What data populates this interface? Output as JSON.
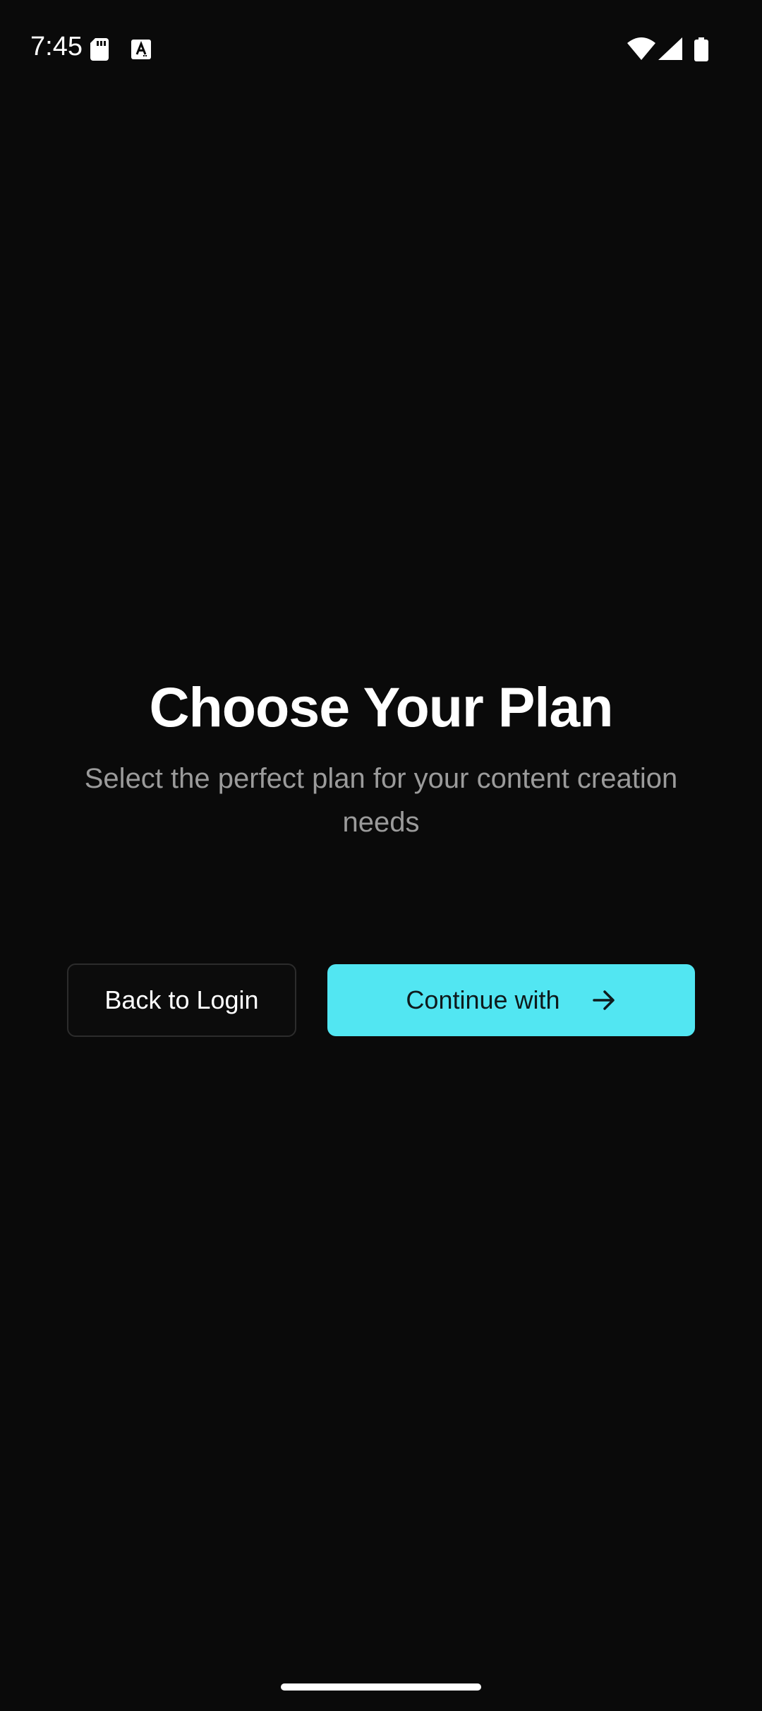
{
  "status_bar": {
    "time": "7:45",
    "icons": [
      "sd-card-icon",
      "text-a-icon",
      "wifi-icon",
      "cell-signal-icon",
      "battery-icon"
    ]
  },
  "page": {
    "title": "Choose Your Plan",
    "subtitle": "Select the perfect plan for your content creation needs"
  },
  "actions": {
    "back_label": "Back to Login",
    "continue_label": "Continue with",
    "continue_icon": "arrow-right-icon"
  },
  "colors": {
    "background": "#0a0a0a",
    "accent": "#52e6f2",
    "subtitle": "#9b9b9b"
  }
}
